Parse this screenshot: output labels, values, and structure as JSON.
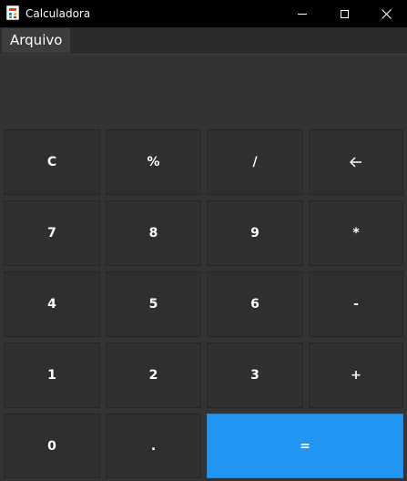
{
  "window": {
    "title": "Calculadora",
    "controls": {
      "minimize": "minimize",
      "maximize": "maximize",
      "close": "close"
    }
  },
  "menu": {
    "items": [
      {
        "label": "Arquivo"
      }
    ]
  },
  "display": {
    "value": ""
  },
  "keypad": {
    "rows": [
      [
        {
          "label": "C",
          "name": "clear"
        },
        {
          "label": "%",
          "name": "percent"
        },
        {
          "label": "/",
          "name": "divide"
        },
        {
          "label": "",
          "name": "backspace",
          "icon": "arrow-left-icon"
        }
      ],
      [
        {
          "label": "7",
          "name": "digit-7"
        },
        {
          "label": "8",
          "name": "digit-8"
        },
        {
          "label": "9",
          "name": "digit-9"
        },
        {
          "label": "*",
          "name": "multiply"
        }
      ],
      [
        {
          "label": "4",
          "name": "digit-4"
        },
        {
          "label": "5",
          "name": "digit-5"
        },
        {
          "label": "6",
          "name": "digit-6"
        },
        {
          "label": "-",
          "name": "subtract"
        }
      ],
      [
        {
          "label": "1",
          "name": "digit-1"
        },
        {
          "label": "2",
          "name": "digit-2"
        },
        {
          "label": "3",
          "name": "digit-3"
        },
        {
          "label": "+",
          "name": "add"
        }
      ],
      [
        {
          "label": "0",
          "name": "digit-0"
        },
        {
          "label": ".",
          "name": "decimal"
        },
        {
          "label": "=",
          "name": "equals"
        }
      ]
    ]
  },
  "colors": {
    "equals_accent": "#2196f3",
    "key_background": "#2f2f2f",
    "window_background": "#333333",
    "titlebar": "#000000"
  }
}
